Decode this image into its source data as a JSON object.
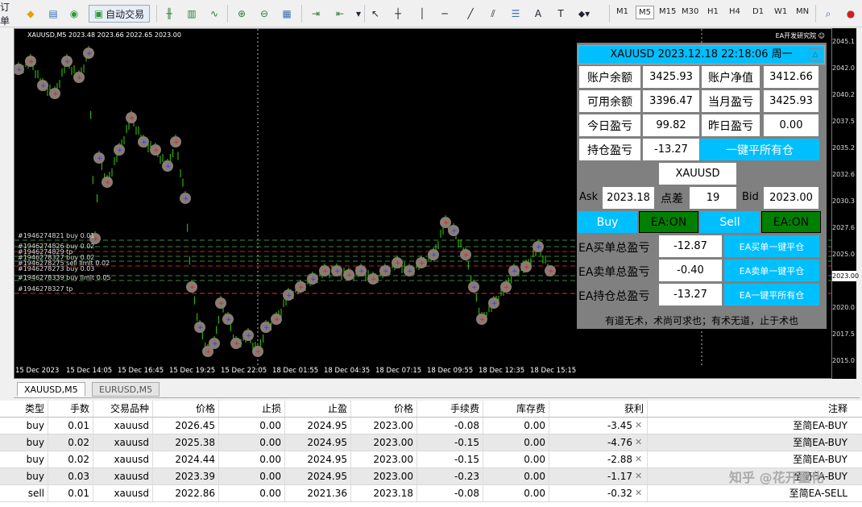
{
  "toolbar": {
    "menu_partial": "订单",
    "autotrade_label": "自动交易",
    "timeframes": [
      "M1",
      "M5",
      "M15",
      "M30",
      "H1",
      "H4",
      "D1",
      "W1",
      "MN"
    ],
    "active_timeframe": "M5"
  },
  "chart": {
    "title": "XAUUSD,M5  2023.48 2023.66 2022.65 2023.00",
    "ea_tag": "EA开发研究院",
    "order_labels": [
      "#1946274821 buy 0.01",
      "#1946274826 buy 0.02",
      "#1946274829 tp",
      "#1946278327 buy 0.02",
      "#1946278275 sell limit 0.02",
      "#1946278273 buy 0.03",
      "#1946278339 buy limit 0.05",
      "#1946278327 tp"
    ],
    "price_ticks": [
      "2045.1",
      "2042.0",
      "2040.2",
      "2037.5",
      "2035.2",
      "2032.6",
      "2030.3",
      "2027.6",
      "2025.0",
      "2023.00",
      "2020.0",
      "2017.5",
      "2015.0"
    ],
    "current_price": "2023.00",
    "time_labels": [
      "15 Dec 2023",
      "15 Dec 14:05",
      "15 Dec 16:45",
      "15 Dec 19:25",
      "15 Dec 22:05",
      "18 Dec 01:55",
      "18 Dec 04:35",
      "18 Dec 07:15",
      "18 Dec 09:55",
      "18 Dec 12:35",
      "18 Dec 15:15"
    ]
  },
  "ea": {
    "header": "XAUUSD 2023.12.18 22:18:06 周一",
    "balance_label": "账户余额",
    "balance": "3425.93",
    "equity_label": "账户净值",
    "equity": "3412.66",
    "free_label": "可用余额",
    "free": "3396.47",
    "month_label": "当月盈亏",
    "month": "3425.93",
    "today_label": "今日盈亏",
    "today": "99.82",
    "yesterday_label": "昨日盈亏",
    "yesterday": "0.00",
    "pos_label": "持仓盈亏",
    "pos": "-13.27",
    "close_all_label": "一键平所有仓",
    "symbol": "XAUUSD",
    "ask_label": "Ask",
    "ask": "2023.18",
    "spread_label": "点差",
    "spread": "19",
    "bid_label": "Bid",
    "bid": "2023.00",
    "buy_label": "Buy",
    "ea_on_buy": "EA:ON",
    "sell_label": "Sell",
    "ea_on_sell": "EA:ON",
    "ea_buy_pnl_label": "EA买单总盈亏",
    "ea_buy_pnl": "-12.87",
    "ea_buy_close_label": "EA买单一键平仓",
    "ea_sell_pnl_label": "EA卖单总盈亏",
    "ea_sell_pnl": "-0.40",
    "ea_sell_close_label": "EA卖单一键平仓",
    "ea_pos_pnl_label": "EA持仓总盈亏",
    "ea_pos_pnl": "-13.27",
    "ea_close_all_label": "EA一键平所有仓",
    "motto": "有道无术，术尚可求也；有术无道，止于术也",
    "colors": {
      "header": "#00bfff",
      "button": "#00bfff",
      "on": "#008000"
    }
  },
  "tabs": [
    {
      "label": "XAUUSD,M5"
    },
    {
      "label": "EURUSD,M5"
    }
  ],
  "trades": {
    "headers": [
      "类型",
      "手数",
      "交易品种",
      "价格",
      "止损",
      "止盈",
      "价格",
      "手续费",
      "库存费",
      "获利",
      "注释"
    ],
    "rows": [
      [
        "buy",
        "0.01",
        "xauusd",
        "2026.45",
        "0.00",
        "2024.95",
        "2023.00",
        "-0.08",
        "0.00",
        "-3.45",
        "至简EA-BUY"
      ],
      [
        "buy",
        "0.02",
        "xauusd",
        "2025.38",
        "0.00",
        "2024.95",
        "2023.00",
        "-0.15",
        "0.00",
        "-4.76",
        "至简EA-BUY"
      ],
      [
        "buy",
        "0.02",
        "xauusd",
        "2024.44",
        "0.00",
        "2024.95",
        "2023.00",
        "-0.15",
        "0.00",
        "-2.88",
        "至简EA-BUY"
      ],
      [
        "buy",
        "0.03",
        "xauusd",
        "2023.39",
        "0.00",
        "2024.95",
        "2023.00",
        "-0.23",
        "0.00",
        "-1.17",
        "至简EA-BUY"
      ],
      [
        "sell",
        "0.01",
        "xauusd",
        "2022.86",
        "0.00",
        "2021.36",
        "2023.18",
        "-0.08",
        "0.00",
        "-0.32",
        "至简EA-SELL"
      ]
    ]
  },
  "watermark": "知乎 @花开量化"
}
